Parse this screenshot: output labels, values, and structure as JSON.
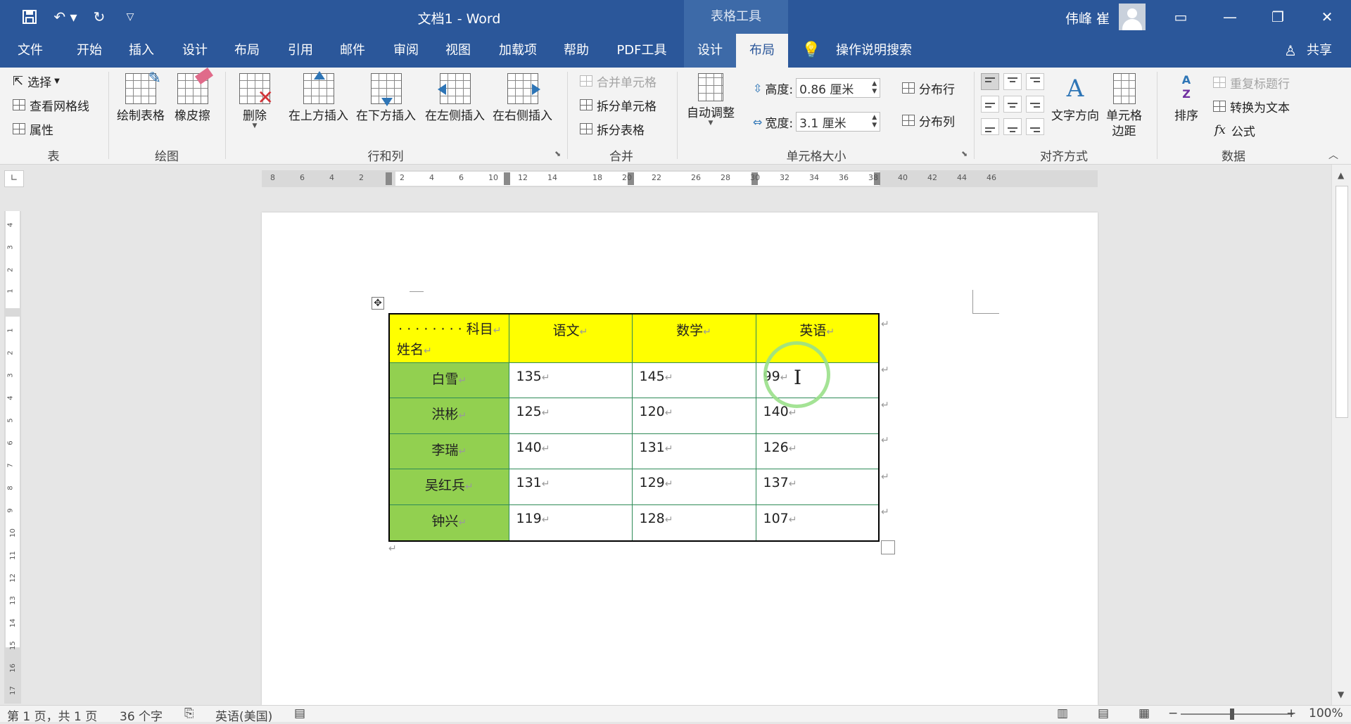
{
  "titlebar": {
    "doc_title": "文档1  -  Word",
    "table_tools": "表格工具",
    "username": "伟峰 崔",
    "icons": {
      "save": "save-icon",
      "undo": "undo-icon",
      "redo": "redo-icon",
      "customize": "customize-qat-icon"
    },
    "window_buttons": {
      "ribbon_options": "▭",
      "minimize": "—",
      "restore": "❐",
      "close": "✕"
    }
  },
  "tabs": [
    "文件",
    "开始",
    "插入",
    "设计",
    "布局",
    "引用",
    "邮件",
    "审阅",
    "视图",
    "加载项",
    "帮助",
    "PDF工具",
    "设计",
    "布局"
  ],
  "tell_me": "操作说明搜索",
  "share": "共享",
  "ribbon": {
    "table": {
      "select": "选择",
      "gridlines": "查看网格线",
      "properties": "属性",
      "group": "表"
    },
    "draw": {
      "draw_table": "绘制表格",
      "eraser": "橡皮擦",
      "group": "绘图"
    },
    "rowscols": {
      "delete": "删除",
      "insert_above": "在上方插入",
      "insert_below": "在下方插入",
      "insert_left": "在左侧插入",
      "insert_right": "在右侧插入",
      "group": "行和列"
    },
    "merge": {
      "merge_cells": "合并单元格",
      "split_cells": "拆分单元格",
      "split_table": "拆分表格",
      "group": "合并"
    },
    "cellsize": {
      "autofit": "自动调整",
      "height_label": "高度:",
      "height_value": "0.86 厘米",
      "width_label": "宽度:",
      "width_value": "3.1 厘米",
      "distribute_rows": "分布行",
      "distribute_cols": "分布列",
      "group": "单元格大小"
    },
    "alignment": {
      "text_direction": "文字方向",
      "cell_margins": "单元格\n边距",
      "group": "对齐方式"
    },
    "data": {
      "sort": "排序",
      "repeat_header": "重复标题行",
      "convert_text": "转换为文本",
      "formula": "公式",
      "group": "数据"
    }
  },
  "ruler_h": [
    "8",
    "6",
    "4",
    "2",
    "2",
    "4",
    "6",
    "10",
    "12",
    "14",
    "18",
    "20",
    "22",
    "26",
    "28",
    "30",
    "32",
    "34",
    "36",
    "38",
    "40",
    "42",
    "44",
    "46"
  ],
  "ruler_v": [
    "4",
    "3",
    "2",
    "1",
    "1",
    "2",
    "3",
    "4",
    "5",
    "6",
    "7",
    "8",
    "9",
    "10",
    "11",
    "12",
    "13",
    "14",
    "15",
    "16",
    "17"
  ],
  "table": {
    "header_top": "· · · · · · · · 科目",
    "header_bottom": "姓名",
    "columns": [
      "语文",
      "数学",
      "英语"
    ],
    "rows": [
      {
        "name": "白雪",
        "values": [
          "135",
          "145",
          "99"
        ]
      },
      {
        "name": "洪彬",
        "values": [
          "125",
          "120",
          "140"
        ]
      },
      {
        "name": "李瑞",
        "values": [
          "140",
          "131",
          "126"
        ]
      },
      {
        "name": "吴红兵",
        "values": [
          "131",
          "129",
          "137"
        ]
      },
      {
        "name": "钟兴",
        "values": [
          "119",
          "128",
          "107"
        ]
      }
    ],
    "colors": {
      "header_bg": "#ffff00",
      "name_bg": "#92d050",
      "border": "#2e8b57"
    }
  },
  "status": {
    "page": "第 1 页，共 1 页",
    "words": "36 个字",
    "language": "英语(美国)",
    "zoom": "100%"
  }
}
